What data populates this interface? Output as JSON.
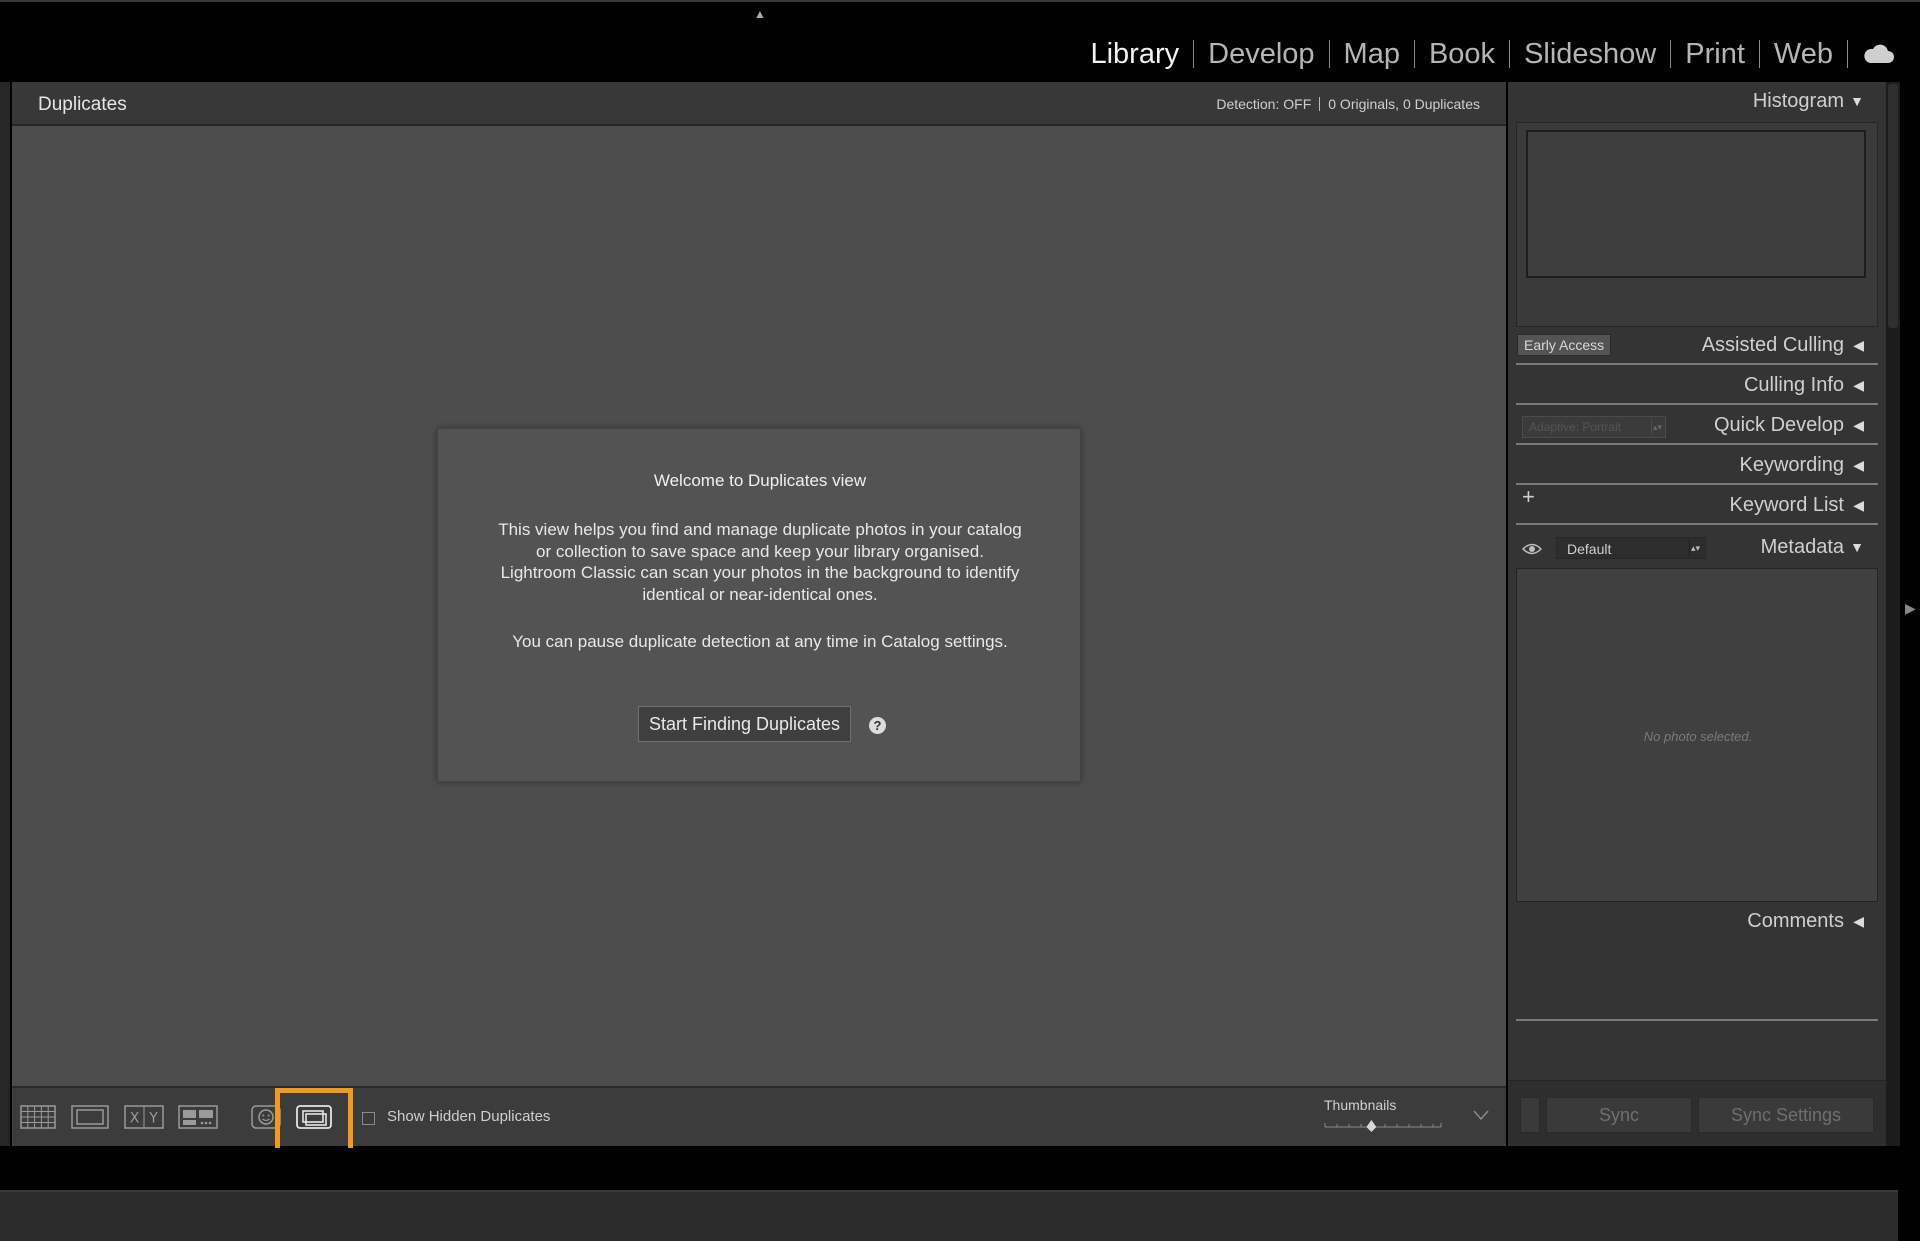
{
  "modules": [
    "Library",
    "Develop",
    "Map",
    "Book",
    "Slideshow",
    "Print",
    "Web"
  ],
  "active_module": "Library",
  "center": {
    "title": "Duplicates",
    "detection_status": "Detection: OFF",
    "counts": "0 Originals, 0 Duplicates"
  },
  "dialog": {
    "title": "Welcome to Duplicates view",
    "body": "This view helps you find and manage duplicate photos in your catalog or collection to save space and keep your library organised. Lightroom Classic can scan your photos in the background to identify identical or near-identical ones.",
    "body2": "You can pause duplicate detection at any time in Catalog settings.",
    "button": "Start Finding Duplicates",
    "help": "?"
  },
  "toolbar": {
    "show_hidden_label": "Show Hidden Duplicates",
    "show_hidden_checked": false,
    "thumbnails_label": "Thumbnails",
    "thumbnails_value": 0.4,
    "view_buttons": [
      "grid-view",
      "loupe-view",
      "compare-view",
      "survey-view",
      "people-view",
      "duplicates-view"
    ],
    "active_view": "duplicates-view",
    "compare_label": "X|Y"
  },
  "right_panel": {
    "histogram": "Histogram",
    "early_access": "Early Access",
    "assisted_culling": "Assisted Culling",
    "culling_info": "Culling Info",
    "quick_develop": "Quick Develop",
    "quick_develop_preset": "Adaptive: Portrait",
    "keywording": "Keywording",
    "keyword_list": "Keyword List",
    "keyword_add": "+",
    "metadata": "Metadata",
    "metadata_preset": "Default",
    "no_photo": "No photo selected.",
    "comments": "Comments",
    "sync": "Sync",
    "sync_settings": "Sync Settings"
  },
  "colors": {
    "highlight": "#f29a1d",
    "active_module": "#f2f2f2",
    "inactive_module": "#b4b4b4"
  },
  "icons": [
    "cloud-icon",
    "help-icon",
    "eye-icon",
    "triangle-down-icon",
    "triangle-left-icon",
    "grid-icon",
    "loupe-icon",
    "compare-icon",
    "survey-icon",
    "people-icon",
    "duplicates-icon"
  ]
}
